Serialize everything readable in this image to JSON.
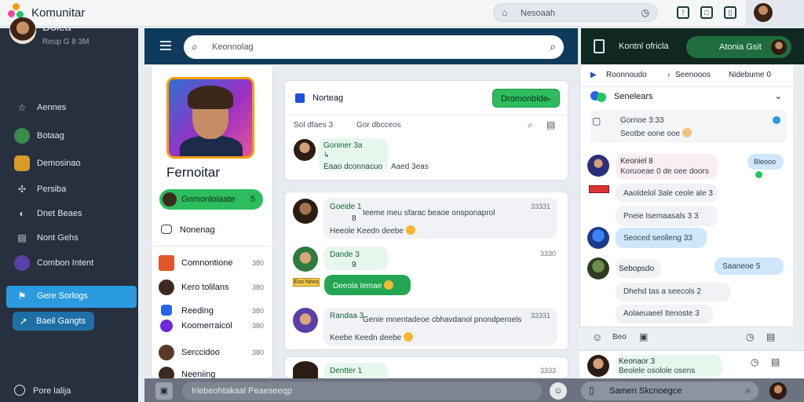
{
  "app": {
    "title": "Komunitar"
  },
  "topbar": {
    "search_placeholder": "Nesoaah"
  },
  "sidebar": {
    "profile": {
      "name": "Dolea",
      "sub": "Reup  G 8  3M"
    },
    "items": [
      {
        "label": "Aennes",
        "icon": "star-icon"
      },
      {
        "label": "Botaag",
        "icon": "game-icon"
      },
      {
        "label": "Demosinao",
        "icon": "chest-icon"
      },
      {
        "label": "Persiba",
        "icon": "puzzle-icon"
      },
      {
        "label": "Dnet Beaes",
        "icon": "globe-icon"
      },
      {
        "label": "Nont Gehs",
        "icon": "grid-icon"
      },
      {
        "label": "Combon Intent",
        "icon": "planet-icon"
      },
      {
        "label": "Gere Sorlogs",
        "icon": "flag-icon"
      },
      {
        "label": "Baeil Gangts",
        "icon": "rocket-icon"
      }
    ],
    "bottom_label": "Pore lalija"
  },
  "center": {
    "search_placeholder": "Keonnolag",
    "game_title": "Fernoitar",
    "pill": {
      "label": "Gnmonlolaate",
      "count": "5"
    },
    "messaging_label": "Nonenag",
    "list": [
      {
        "label": "Comnontione",
        "count": "380"
      },
      {
        "label": "Kero tolilans",
        "count": "380"
      },
      {
        "label": "Reeding",
        "count": "380"
      },
      {
        "label": "Koomerraicol",
        "count": "380"
      },
      {
        "label": "Serccidoo",
        "count": "380"
      },
      {
        "label": "Neeniing",
        "count": ""
      }
    ],
    "post": {
      "title": "Norteag",
      "button": "Dromonbide",
      "meta_left": "Sol dfaes  3",
      "meta_right": "Gor dbcceos",
      "comment_name": "Goniner  3a",
      "comment_text": "Eaao dconnacuo",
      "comment_side": "Aaed 3eas"
    },
    "messages": [
      {
        "name": "Goeide  1",
        "sub": "8",
        "text": "Ieeme meu sfarac beaoe onsponaprol",
        "line2": "Heeole  Keedn deebe",
        "time": "33331"
      },
      {
        "name": "Dande  3",
        "sub": "9",
        "text": "",
        "line2": "",
        "time": "3330"
      },
      {
        "name": "Randaa  3",
        "sub": "",
        "text": "Genie mnentadeoe cbhavdanol pnondperoels",
        "line2": "Keebe  Keedn deebe",
        "time": "33331"
      },
      {
        "name": "Dentter  1",
        "sub": "",
        "text": "",
        "line2": "",
        "time": "3333"
      }
    ],
    "green_reply": "Deeola  Iemae",
    "tag": "Eoo Neeo",
    "composer_placeholder": "Iriebeohtakaal Peaeseeqp"
  },
  "right": {
    "header_title": "Kontnl ofricla",
    "header_btn": "Atonia Gsit",
    "tabs": [
      "Roonnoudo",
      "Seenooos",
      "Nidebume  0"
    ],
    "section_title": "Senelears",
    "notice": {
      "line1": "Gornoe  3:33",
      "line2": "Seotbe  oone ooe"
    },
    "chat": [
      {
        "name": "Keoniel  8",
        "text": "Koruoeae  0 de  oee doors",
        "badge": "Bleooo"
      },
      {
        "text": "Aaoldelol  3ale ceole  ale  3"
      },
      {
        "text": "Pneie  Isemaasals  3  3"
      },
      {
        "text": "Seoced  seolleng  33"
      },
      {
        "name": "Sebopsdo",
        "badge": "Saaneoe  5"
      },
      {
        "text": "Dhehd  tas  a  seecols  2"
      },
      {
        "text": "Aolaeuaeel  Itenoste  3"
      }
    ],
    "footer_label": "Beo",
    "bottom_card": {
      "name": "Keonaor  3",
      "text": "Beolele  osolole  osens"
    },
    "search_placeholder": "Samen Skcnoegce"
  },
  "colors": {
    "accent": "#2b9be0",
    "green": "#2ebd5e",
    "dark": "#27303e"
  }
}
